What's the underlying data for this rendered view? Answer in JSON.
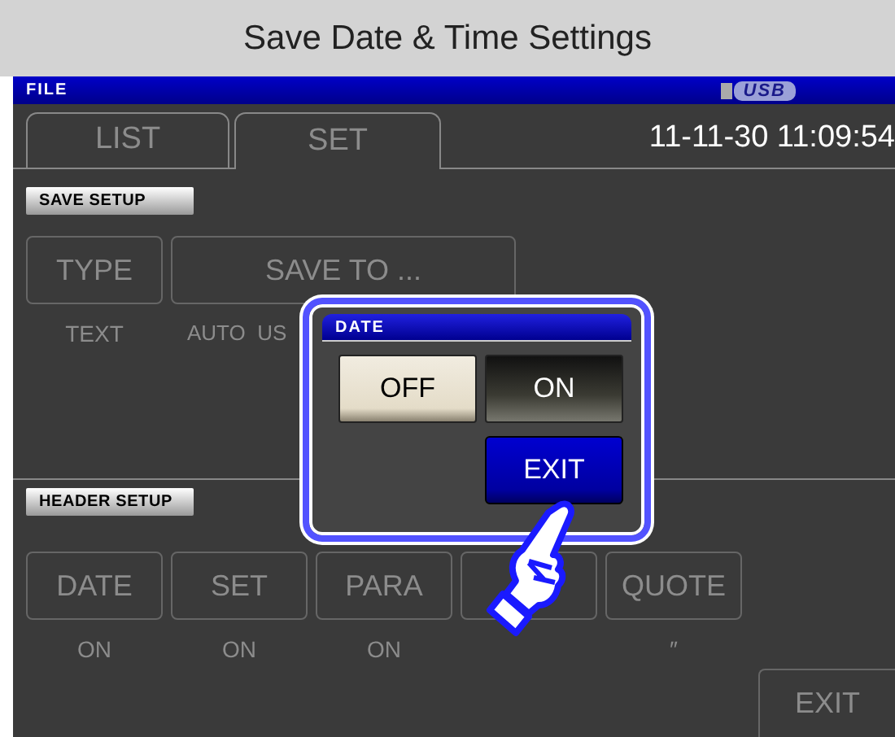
{
  "page_title": "Save Date & Time Settings",
  "header": {
    "title": "FILE",
    "usb": "USB"
  },
  "tabs": [
    {
      "label": "LIST",
      "selected": false
    },
    {
      "label": "SET",
      "selected": true
    }
  ],
  "datetime": "11-11-30 11:09:54",
  "sections": [
    {
      "heading": "SAVE SETUP",
      "buttons": [
        {
          "label": "TYPE",
          "value": "TEXT",
          "kind": "normal"
        },
        {
          "label": "SAVE TO ...",
          "value": "AUTO  US",
          "kind": "wide"
        }
      ]
    },
    {
      "heading": "HEADER SETUP",
      "buttons": [
        {
          "label": "DATE",
          "value": "ON",
          "kind": "normal"
        },
        {
          "label": "SET",
          "value": "ON",
          "kind": "normal"
        },
        {
          "label": "PARA",
          "value": "ON",
          "kind": "normal"
        },
        {
          "kind": "normal"
        },
        {
          "label": "QUOTE",
          "value": "″",
          "kind": "normal"
        }
      ]
    }
  ],
  "dialog": {
    "title": "DATE",
    "options": [
      {
        "label": "OFF",
        "selected": true
      },
      {
        "label": "ON",
        "selected": false
      }
    ],
    "exit": "EXIT"
  },
  "exit_button": "EXIT"
}
